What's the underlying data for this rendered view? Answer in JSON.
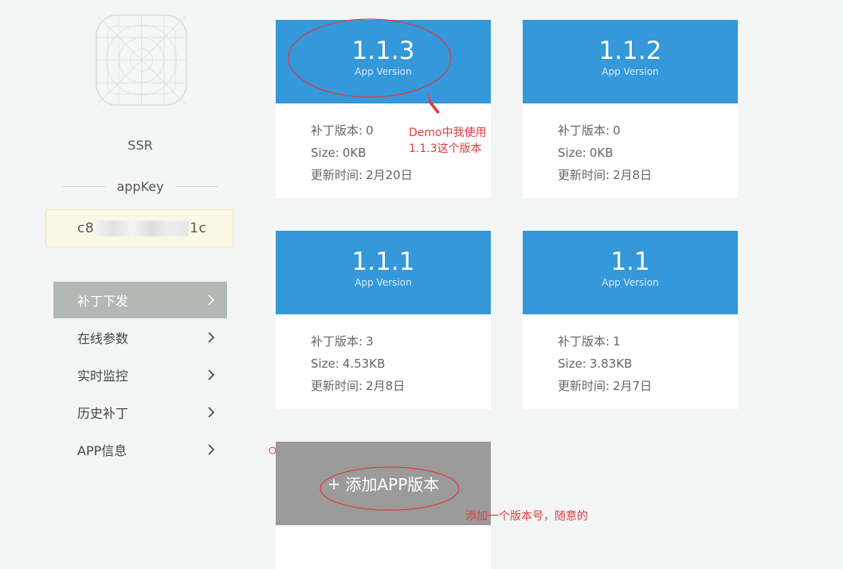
{
  "sidebar": {
    "app_name": "SSR",
    "appkey_label": "appKey",
    "appkey_prefix": "c8",
    "appkey_suffix": "1c",
    "menu": [
      {
        "label": "补丁下发",
        "active": true
      },
      {
        "label": "在线参数",
        "active": false
      },
      {
        "label": "实时监控",
        "active": false
      },
      {
        "label": "历史补丁",
        "active": false
      },
      {
        "label": "APP信息",
        "active": false
      }
    ]
  },
  "cards": [
    {
      "version": "1.1.3",
      "subtitle": "App Version",
      "patch_label": "补丁版本:",
      "patch": "0",
      "size_label": "Size:",
      "size": "0KB",
      "updated_label": "更新时间:",
      "updated": "2月20日"
    },
    {
      "version": "1.1.2",
      "subtitle": "App Version",
      "patch_label": "补丁版本:",
      "patch": "0",
      "size_label": "Size:",
      "size": "0KB",
      "updated_label": "更新时间:",
      "updated": "2月8日"
    },
    {
      "version": "1.1.1",
      "subtitle": "App Version",
      "patch_label": "补丁版本:",
      "patch": "3",
      "size_label": "Size:",
      "size": "4.53KB",
      "updated_label": "更新时间:",
      "updated": "2月8日"
    },
    {
      "version": "1.1",
      "subtitle": "App Version",
      "patch_label": "补丁版本:",
      "patch": "1",
      "size_label": "Size:",
      "size": "3.83KB",
      "updated_label": "更新时间:",
      "updated": "2月7日"
    }
  ],
  "add_button": {
    "plus": "+",
    "label": "添加APP版本"
  },
  "annotations": {
    "demo_line1": "Demo中我使用",
    "demo_line2": "1.1.3这个版本",
    "add_note": "添加一个版本号，随意的"
  },
  "colors": {
    "card_header": "#3498db",
    "menu_active": "#b0b9b4",
    "add_button": "#9b9b9b",
    "annotation": "#e23b3b",
    "appkey_bg": "#fdf8e6"
  },
  "icons": [
    "app-icon-placeholder",
    "chevron-right-icon"
  ]
}
